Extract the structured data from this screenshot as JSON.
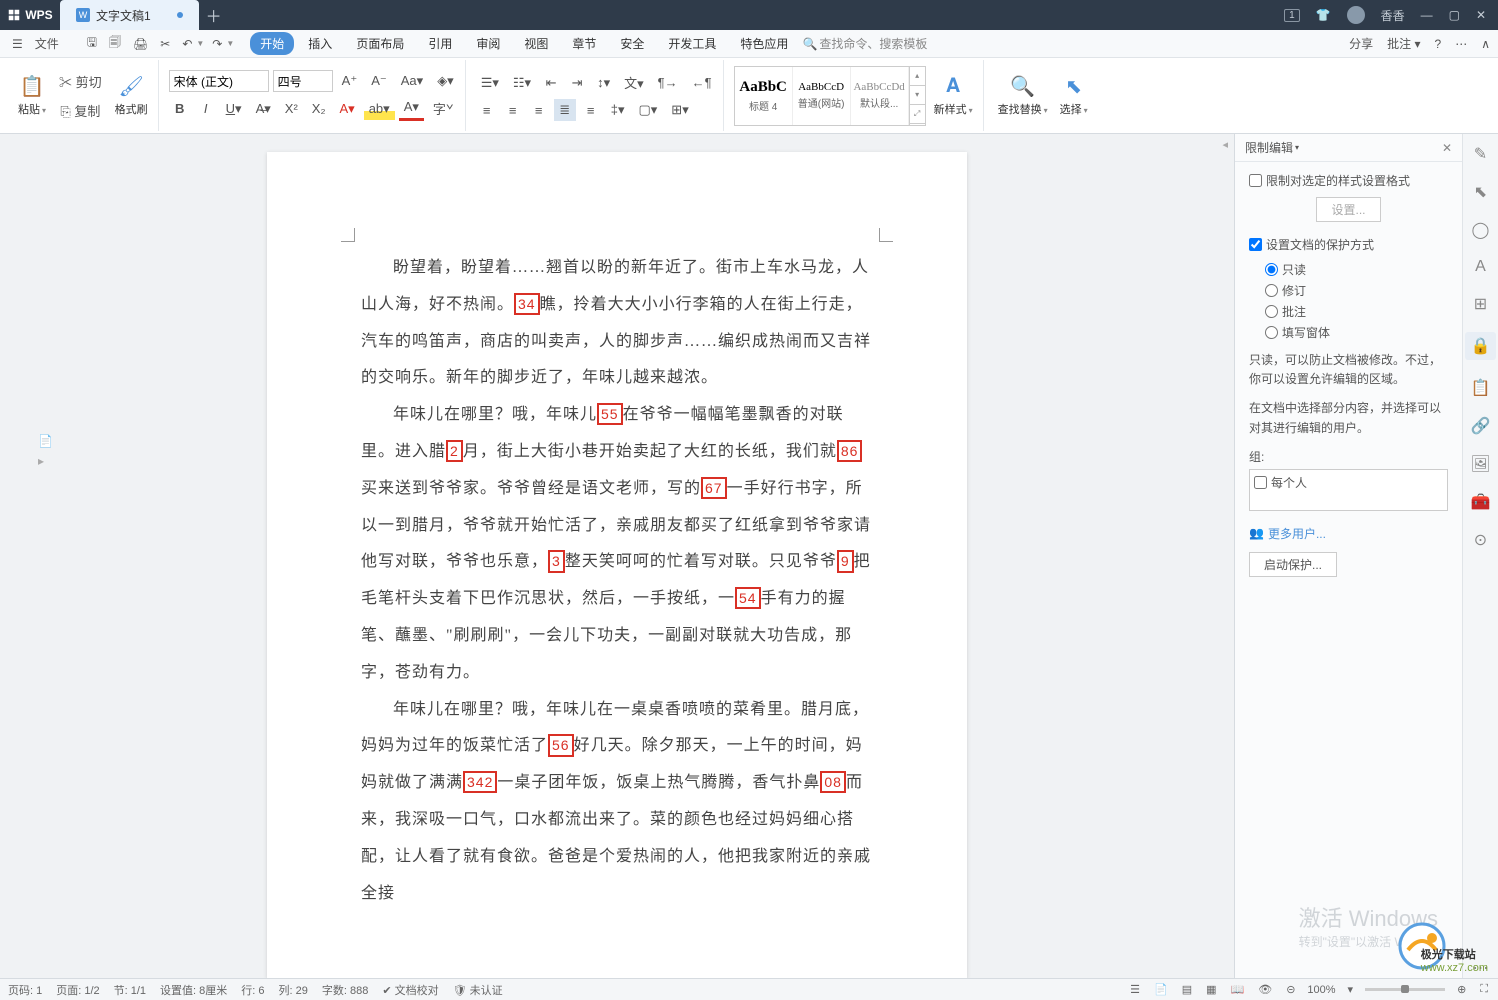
{
  "app": {
    "name": "WPS",
    "doc_tab": "文字文稿1",
    "username": "香香"
  },
  "menubar": {
    "file": "文件",
    "tabs": [
      "开始",
      "插入",
      "页面布局",
      "引用",
      "审阅",
      "视图",
      "章节",
      "安全",
      "开发工具",
      "特色应用"
    ],
    "active_tab": 0,
    "search_cmd": "查找命令、搜索模板",
    "right": {
      "share": "分享",
      "annotate": "批注"
    }
  },
  "ribbon": {
    "paste": "粘贴",
    "cut": "剪切",
    "copy": "复制",
    "format_painter": "格式刷",
    "font_name": "宋体 (正文)",
    "font_size": "四号",
    "styles": [
      {
        "preview": "AaBbC",
        "name": "标题 4"
      },
      {
        "preview": "AaBbCcD",
        "name": "普通(网站)"
      },
      {
        "preview": "AaBbCcDd",
        "name": "默认段..."
      }
    ],
    "new_style": "新样式",
    "find_replace": "查找替换",
    "select": "选择"
  },
  "panel": {
    "title": "限制编辑",
    "opt_format": "限制对选定的样式设置格式",
    "btn_settings": "设置...",
    "opt_protect": "设置文档的保护方式",
    "radios": {
      "readonly": "只读",
      "revision": "修订",
      "comment": "批注",
      "form": "填写窗体"
    },
    "selected_radio": "readonly",
    "desc1": "只读，可以防止文档被修改。不过，你可以设置允许编辑的区域。",
    "desc2": "在文档中选择部分内容，并选择可以对其进行编辑的用户。",
    "group_label": "组:",
    "group_everyone": "每个人",
    "more_users": "更多用户...",
    "start_protect": "启动保护..."
  },
  "document": {
    "p1_a": "盼望着，盼望着……翘首以盼的新年近了。街市上车水马龙，人山人海，好不热闹。",
    "p1_b": "瞧，拎着大大小小行李箱的人在街上行走，汽车的鸣笛声，商店的叫卖声，人的脚步声……编织成热闹而又吉祥的交响乐。新年的脚步近了，年味儿越来越浓。",
    "p2_a": "年味儿在哪里？哦，年味儿",
    "p2_b": "在爷爷一幅幅笔墨飘香的对联里。进入腊",
    "p2_c": "月，街上大街小巷开始卖起了大红的长纸，我们就",
    "p2_d": "买来送到爷爷家。爷爷曾经是语文老师，写的",
    "p2_e": "一手好行书字，所以一到腊月，爷爷就开始忙活了，亲戚朋友都买了红纸拿到爷爷家请他写对联，爷爷也乐意，",
    "p2_f": "整天笑呵呵的忙着写对联。只见爷爷",
    "p2_g": "把毛笔杆头支着下巴作沉思状，然后，一手按纸，一",
    "p2_h": "手有力的握笔、蘸墨、\"刷刷刷\"，一会儿下功夫，一副副对联就大功告成，那字，苍劲有力。",
    "p3_a": "年味儿在哪里？哦，年味儿在一桌桌香喷喷的菜肴里。腊月底，妈妈为过年的饭菜忙活了",
    "p3_b": "好几天。除夕那天，一上午的时间，妈妈就做了满满",
    "p3_c": "一桌子团年饭，饭桌上热气腾腾，香气扑鼻",
    "p3_d": "而来，我深吸一口气，口水都流出来了。菜的颜色也经过妈妈细心搭配，让人看了就有食欲。爸爸是个爱热闹的人，他把我家附近的亲戚全接",
    "boxes": {
      "b1": "34",
      "b2": "55",
      "b3": "2",
      "b4": "86",
      "b5": "67",
      "b6": "3",
      "b7": "9",
      "b8": "54",
      "b9": "56",
      "b10": "342",
      "b11": "08"
    }
  },
  "status": {
    "page_num": "页码: 1",
    "page": "页面: 1/2",
    "section": "节: 1/1",
    "indent": "设置值: 8厘米",
    "line": "行: 6",
    "col": "列: 29",
    "words": "字数: 888",
    "spell": "文档校对",
    "verify": "未认证",
    "zoom": "100%"
  },
  "watermark": {
    "line1": "激活 Windows",
    "line2": "转到\"设置\"以激活 W"
  },
  "corner_logo": {
    "brand": "极光下载站",
    "url": "www.xz7.com"
  }
}
